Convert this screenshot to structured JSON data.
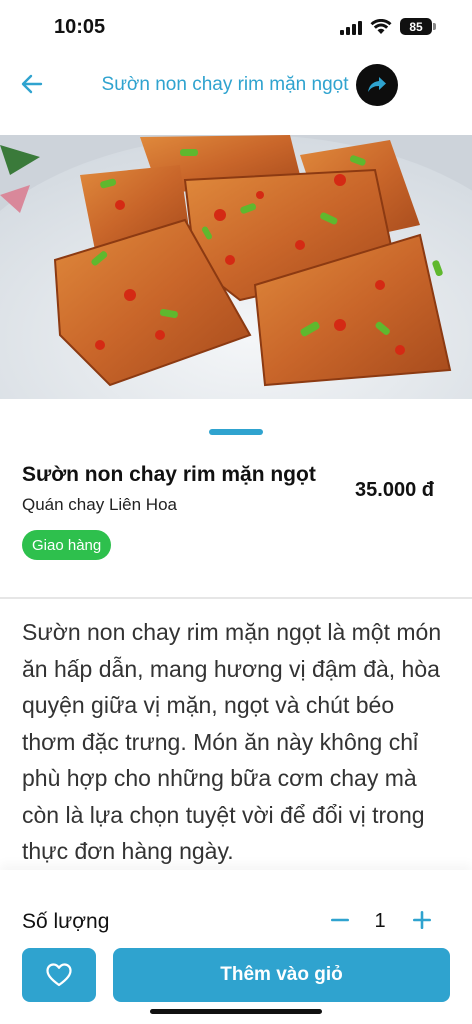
{
  "status_bar": {
    "time": "10:05",
    "battery": "85"
  },
  "header": {
    "title": "Sườn non chay rim mặn ngọt",
    "back_icon": "arrow-left-icon",
    "share_icon": "share-icon"
  },
  "product": {
    "name": "Sườn non chay rim mặn ngọt",
    "restaurant": "Quán chay Liên Hoa",
    "price": "35.000 đ",
    "badge": "Giao hàng"
  },
  "description": "Sườn non chay rim mặn ngọt là một món ăn hấp dẫn, mang hương vị đậm đà, hòa quyện giữa vị mặn, ngọt và chút béo thơm đặc trưng. Món ăn này không chỉ phù hợp cho những bữa cơm chay mà còn là lựa chọn tuyệt vời để đổi vị trong thực đơn hàng ngày.",
  "quantity": {
    "label": "Số lượng",
    "value": "1"
  },
  "actions": {
    "add_to_cart": "Thêm vào giỏ",
    "favorite_icon": "heart-icon"
  },
  "colors": {
    "accent": "#2fa3cf",
    "badge": "#2ec04d"
  }
}
